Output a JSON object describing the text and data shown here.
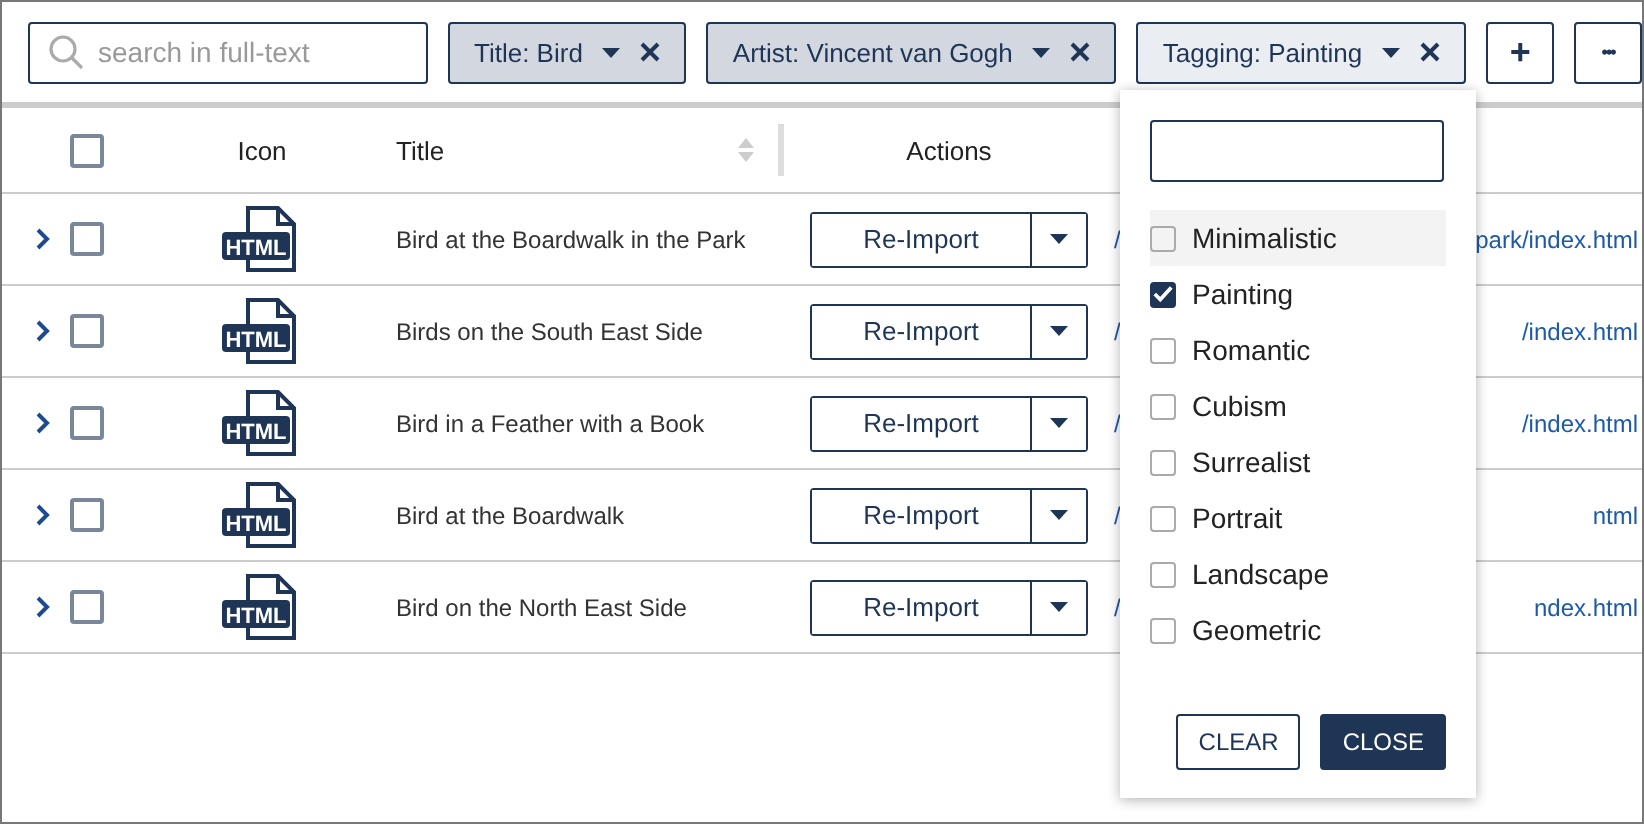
{
  "toolbar": {
    "search": {
      "placeholder": "search in full-text"
    },
    "filters": [
      {
        "label": "Title: Bird",
        "open": false
      },
      {
        "label": "Artist: Vincent van Gogh",
        "open": false
      },
      {
        "label": "Tagging: Painting",
        "open": true
      }
    ],
    "add_button": "+",
    "more_button": "•••"
  },
  "table": {
    "select_all_checked": false,
    "columns": [
      "Icon",
      "Title",
      "Actions"
    ],
    "rows": [
      {
        "checked": false,
        "icon_label": "HTML",
        "title": "Bird at the Boardwalk in the Park",
        "action": "Re-Import",
        "link_start": "/",
        "link_end": "park/index.html"
      },
      {
        "checked": false,
        "icon_label": "HTML",
        "title": "Birds on the South East Side",
        "action": "Re-Import",
        "link_start": "/",
        "link_end": "/index.html"
      },
      {
        "checked": false,
        "icon_label": "HTML",
        "title": "Bird in a Feather with a Book",
        "action": "Re-Import",
        "link_start": "/",
        "link_end": "/index.html"
      },
      {
        "checked": false,
        "icon_label": "HTML",
        "title": "Bird at the Boardwalk",
        "action": "Re-Import",
        "link_start": "/",
        "link_end": "ntml"
      },
      {
        "checked": false,
        "icon_label": "HTML",
        "title": "Bird on the North East Side",
        "action": "Re-Import",
        "link_start": "/",
        "link_end": "ndex.html"
      }
    ]
  },
  "dropdown": {
    "options": [
      {
        "label": "Minimalistic",
        "checked": false,
        "highlighted": true
      },
      {
        "label": "Painting",
        "checked": true,
        "highlighted": false
      },
      {
        "label": "Romantic",
        "checked": false,
        "highlighted": false
      },
      {
        "label": "Cubism",
        "checked": false,
        "highlighted": false
      },
      {
        "label": "Surrealist",
        "checked": false,
        "highlighted": false
      },
      {
        "label": "Portrait",
        "checked": false,
        "highlighted": false
      },
      {
        "label": "Landscape",
        "checked": false,
        "highlighted": false
      },
      {
        "label": "Geometric",
        "checked": false,
        "highlighted": false
      }
    ],
    "clear_button": "CLEAR",
    "close_button": "CLOSE"
  }
}
